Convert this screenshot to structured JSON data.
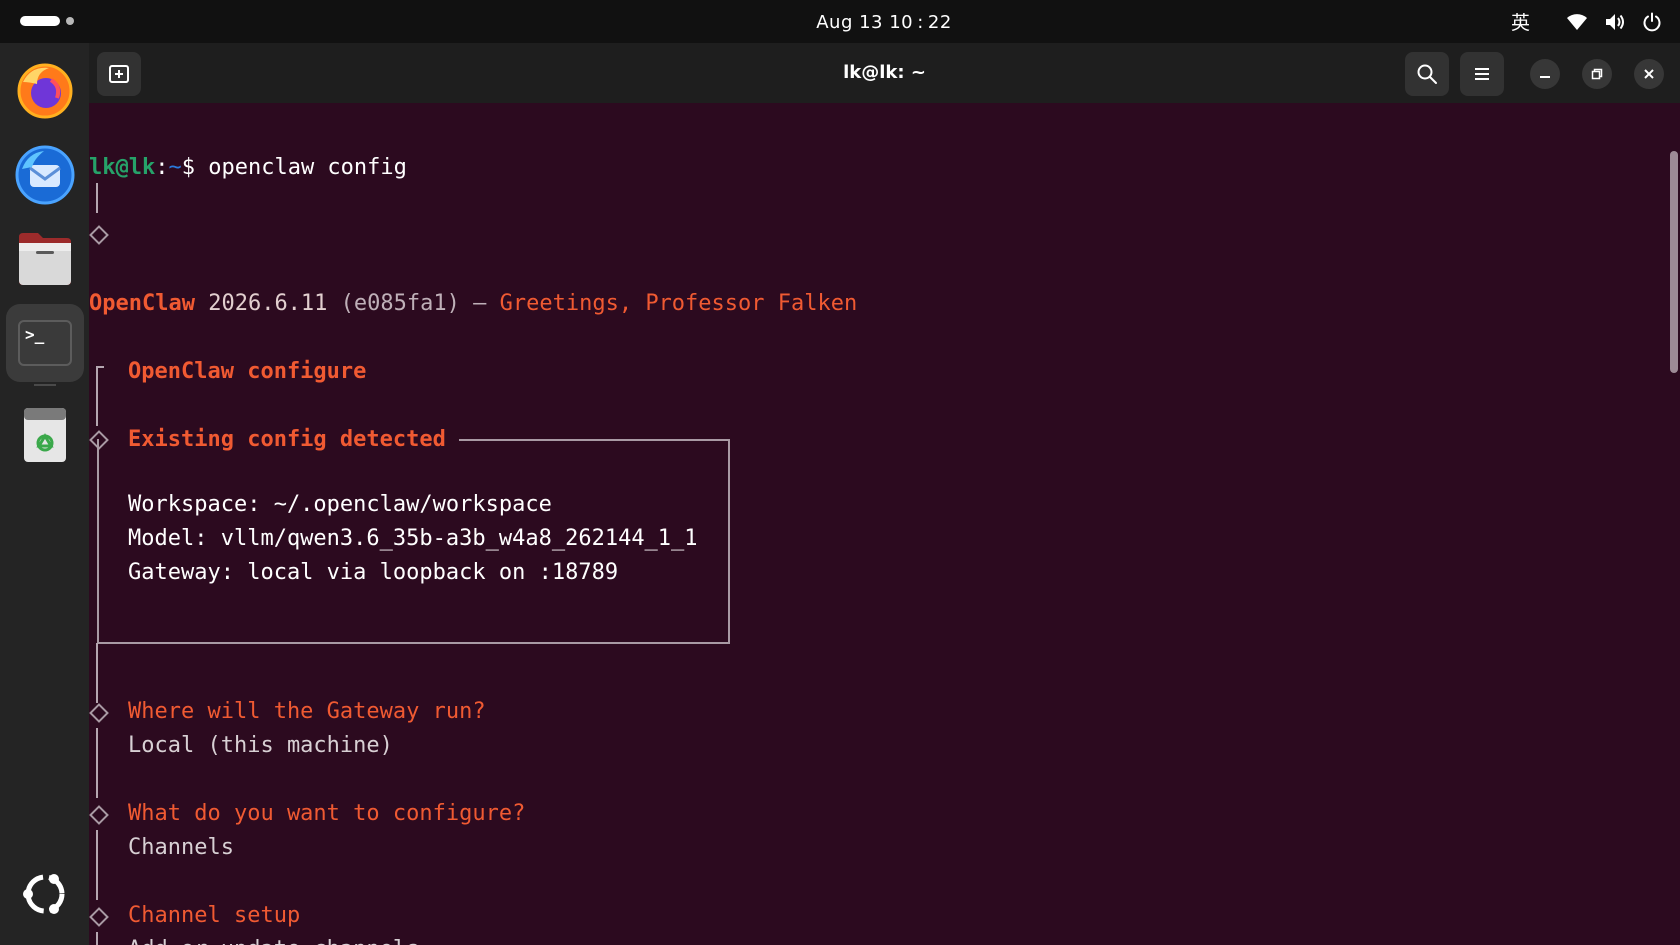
{
  "topbar": {
    "clock": "Aug 13  10 : 22",
    "input_method": "英",
    "icons": [
      "wifi-icon",
      "volume-icon",
      "power-icon"
    ]
  },
  "dock": {
    "apps": [
      "Firefox",
      "Thunderbird",
      "Files",
      "Terminal",
      "Trash"
    ],
    "bottom_icon": "ubuntu-logo"
  },
  "window": {
    "title": "lk@lk: ~",
    "buttons": [
      "new-tab",
      "search",
      "menu",
      "minimize",
      "restore",
      "close"
    ]
  },
  "terminal": {
    "prompt_user": "lk@lk",
    "prompt_sep": ":",
    "prompt_path": "~",
    "prompt_sym": "$",
    "command": " openclaw config",
    "banner": {
      "app": "OpenClaw",
      "version": " 2026.6.11",
      "commit": " (e085fa1)",
      "dash": " — ",
      "greeting": "Greetings, Professor Falken"
    },
    "configure_title": "OpenClaw configure",
    "existing_title": "Existing config detected",
    "config_lines": {
      "workspace": "Workspace: ~/.openclaw/workspace",
      "model": "Model: vllm/qwen3.6_35b-a3b_w4a8_262144_1_1",
      "gateway": "Gateway: local via loopback on :18789"
    },
    "q1": {
      "question": "Where will the Gateway run?",
      "answer": "Local (this machine)"
    },
    "q2": {
      "question": "What do you want to configure?",
      "answer": "Channels"
    },
    "q3": {
      "question": "Channel setup",
      "answer": "Add or update channels"
    }
  },
  "colors": {
    "terminal_bg": "#2c0a1f",
    "prompt_green": "#26a269",
    "prompt_blue": "#2a7bde",
    "accent_orange": "#f05a32"
  }
}
